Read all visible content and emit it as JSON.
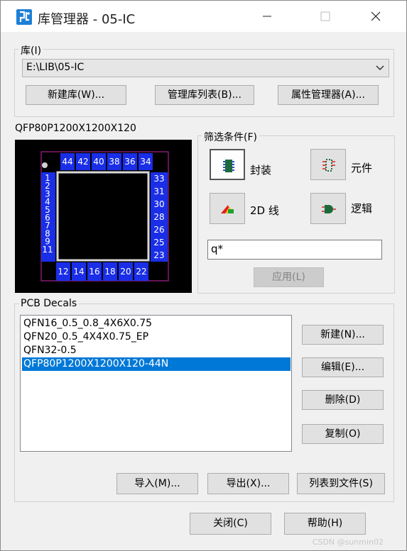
{
  "window": {
    "title": "库管理器 - 05-IC",
    "icon": "pads-app-icon",
    "controls": [
      "minimize-icon",
      "maximize-icon",
      "close-icon"
    ]
  },
  "library": {
    "group_label": "库(I)",
    "selected": "E:\\LIB\\05-IC",
    "buttons": {
      "new": "新建库(W)...",
      "manage_list": "管理库列表(B)...",
      "attributes": "属性管理器(A)..."
    }
  },
  "preview": {
    "title": "QFP80P1200X1200X120-44N",
    "pins_top": [
      "44",
      "42",
      "40",
      "38",
      "36",
      "34"
    ],
    "pins_left": [
      "1",
      "2",
      "3",
      "4",
      "5",
      "6",
      "7",
      "8",
      "9",
      "11"
    ],
    "pins_right": [
      "33",
      "31",
      "30",
      "28",
      "26",
      "25",
      "23"
    ],
    "pins_bottom": [
      "12",
      "14",
      "16",
      "18",
      "20",
      "22"
    ],
    "colors": {
      "pad": "#1a2ee8",
      "outline": "#c82aaa",
      "body": "#d8d8d8"
    }
  },
  "filter": {
    "group_label": "筛选条件(F)",
    "options": [
      {
        "label": "封装",
        "icon": "decal-chip-icon",
        "active": true
      },
      {
        "label": "元件",
        "icon": "part-icon",
        "active": false
      },
      {
        "label": "2D 线",
        "icon": "2d-line-icon",
        "active": false
      },
      {
        "label": "逻辑",
        "icon": "logic-symbol-icon",
        "active": false
      }
    ],
    "search_value": "q*",
    "apply_label": "应用(L)"
  },
  "decals": {
    "group_label": "PCB Decals",
    "items": [
      "QFN16_0.5_0.8_4X6X0.75",
      "QFN20_0.5_4X4X0.75_EP",
      "QFN32-0.5",
      "QFP80P1200X1200X120-44N"
    ],
    "selected_index": 3,
    "buttons": {
      "new": "新建(N)...",
      "edit": "编辑(E)...",
      "delete": "删除(D)",
      "copy": "复制(O)"
    }
  },
  "bottom_buttons": {
    "import": "导入(M)...",
    "export": "导出(X)...",
    "list_to_file": "列表到文件(S)",
    "close": "关闭(C)",
    "help": "帮助(H)"
  },
  "watermark": "CSDN @sunmin02"
}
